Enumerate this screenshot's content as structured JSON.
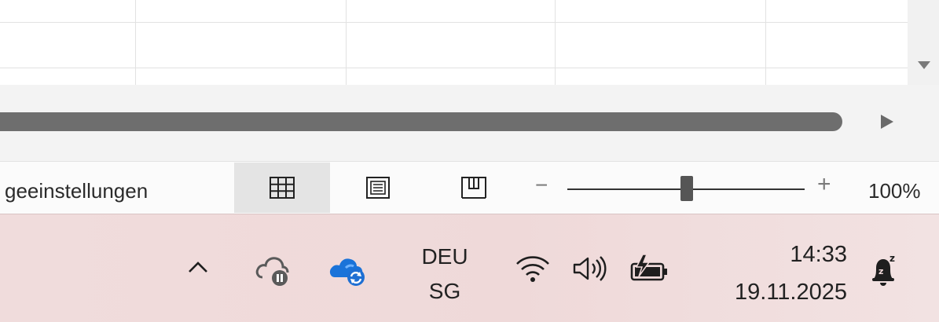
{
  "status_bar": {
    "page_settings_text": "geeinstellungen",
    "views": [
      {
        "name": "normal-view",
        "active": true
      },
      {
        "name": "page-layout-view",
        "active": false
      },
      {
        "name": "page-break-preview",
        "active": false
      }
    ],
    "zoom": {
      "minus": "−",
      "plus": "+",
      "level": "100%",
      "fraction": 0.5
    }
  },
  "taskbar": {
    "tray_items": [
      {
        "icon": "chevron-up-icon"
      },
      {
        "icon": "onedrive-paused-icon"
      },
      {
        "icon": "onedrive-syncing-icon"
      },
      {
        "icon": "wifi-icon"
      },
      {
        "icon": "volume-icon"
      },
      {
        "icon": "battery-charging-icon"
      },
      {
        "icon": "notifications-dnd-icon"
      }
    ],
    "language": {
      "line1": "DEU",
      "line2": "SG"
    },
    "clock": {
      "time": "14:33",
      "date": "19.11.2025"
    }
  },
  "colors": {
    "taskbar_bg": "#efd9d9",
    "scroll_thumb": "#6e6e6e",
    "onedrive_blue": "#1a73d9",
    "active_view_bg": "#e4e4e4"
  }
}
